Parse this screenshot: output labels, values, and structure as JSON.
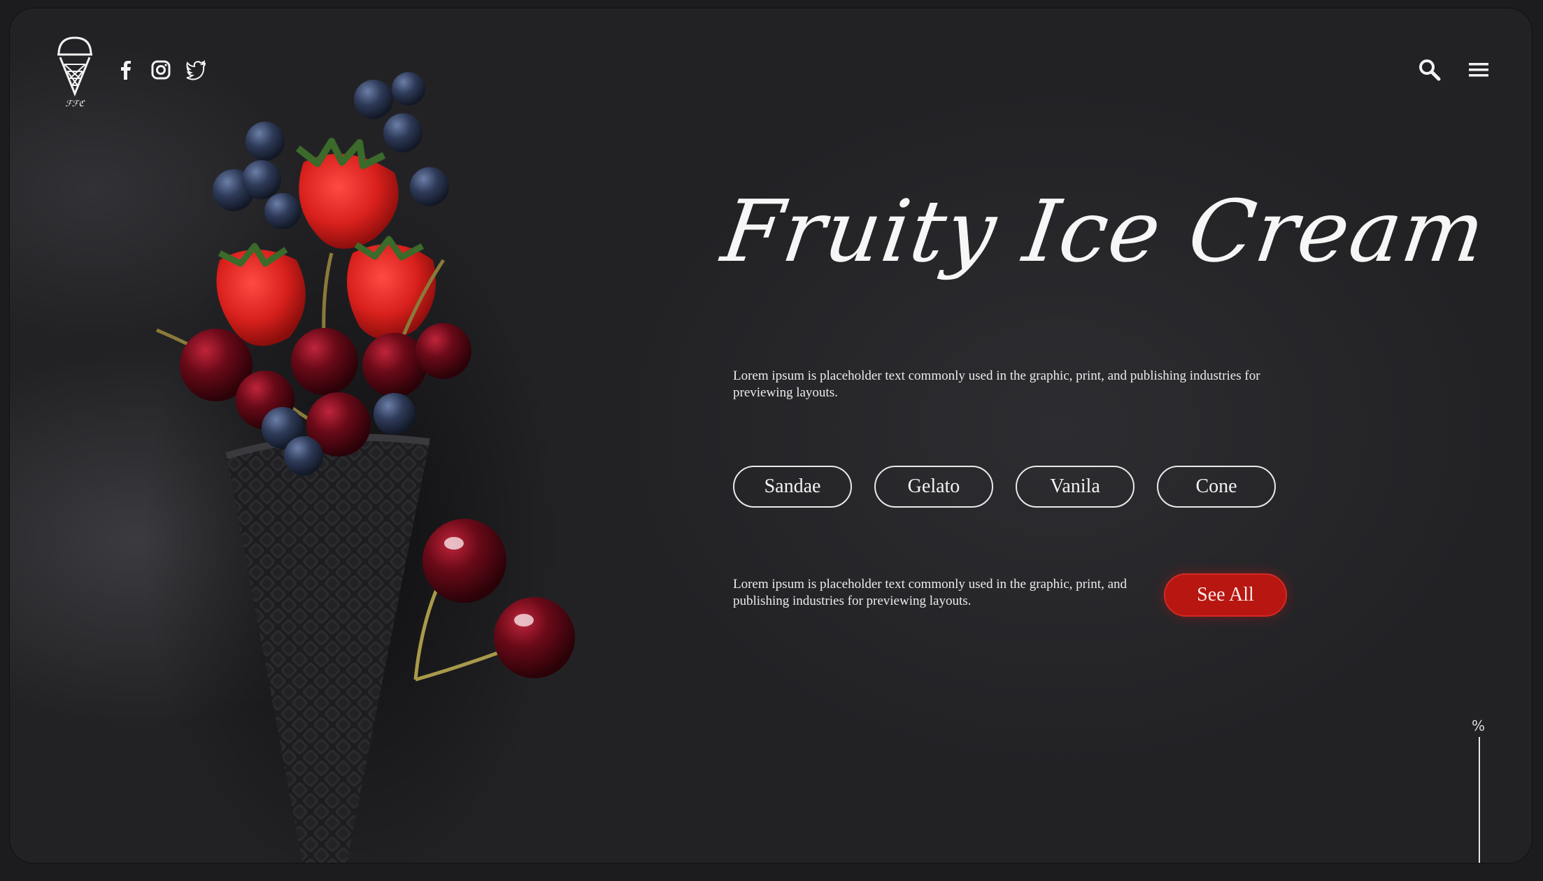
{
  "header": {
    "logo_icon": "ice-cream-cone-logo",
    "social_icons": [
      "facebook-icon",
      "instagram-icon",
      "twitter-icon"
    ],
    "right_icons": [
      "search-icon",
      "menu-icon"
    ]
  },
  "hero": {
    "title": "Fruity Ice Cream",
    "description": "Lorem ipsum is placeholder text commonly used in the graphic, print, and publishing industries for previewing layouts.",
    "categories": [
      "Sandae",
      "Gelato",
      "Vanila",
      "Cone"
    ],
    "footer_text": "Lorem ipsum is placeholder text commonly used in the graphic, print, and publishing industries for previewing layouts.",
    "see_all_label": "See All",
    "scroll_indicator": "%"
  },
  "colors": {
    "background": "#26262a",
    "accent": "#b71611",
    "text": "#f3f3f3"
  }
}
